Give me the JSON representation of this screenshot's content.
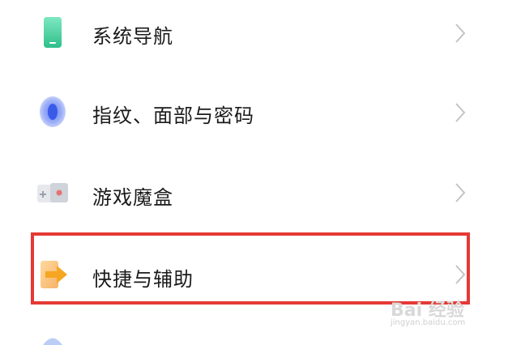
{
  "settings_list": {
    "items": [
      {
        "label": "系统导航",
        "icon": "phone-navigation-icon",
        "color": "#3ecf9a"
      },
      {
        "label": "指纹、面部与密码",
        "icon": "fingerprint-icon",
        "color": "#4a6cf0"
      },
      {
        "label": "游戏魔盒",
        "icon": "game-box-icon",
        "color": "#e57373"
      },
      {
        "label": "快捷与辅助",
        "icon": "shortcut-assist-icon",
        "color": "#f5a623"
      }
    ],
    "highlighted_item": "快捷与辅助",
    "highlight_color": "#e53935"
  },
  "watermark": {
    "text": "Bai 经验",
    "subtext": "jingyan.baidu.com"
  }
}
